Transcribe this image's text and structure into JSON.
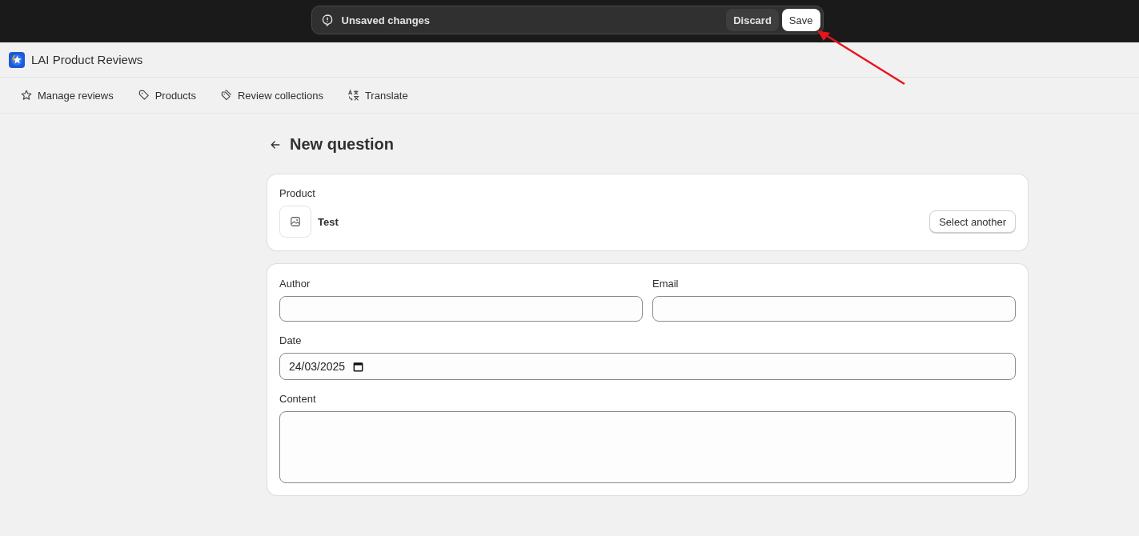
{
  "save_bar": {
    "message": "Unsaved changes",
    "buttons": [
      {
        "label": "Discard",
        "kind": "secondary"
      },
      {
        "label": "Save",
        "kind": "primary"
      }
    ]
  },
  "app": {
    "title": "LAI Product Reviews"
  },
  "nav": [
    {
      "label": "Manage reviews"
    },
    {
      "label": "Products"
    },
    {
      "label": "Review collections"
    },
    {
      "label": "Translate"
    }
  ],
  "page": {
    "title": "New question"
  },
  "product_card": {
    "label": "Product",
    "product_name": "Test",
    "button": "Select another"
  },
  "form": {
    "fields": [
      {
        "label": "Author",
        "kind": "text"
      },
      {
        "label": "Email",
        "kind": "text"
      },
      {
        "label": "Date",
        "value": "24/03/2025",
        "kind": "date"
      },
      {
        "label": "Content",
        "kind": "textarea"
      }
    ]
  }
}
